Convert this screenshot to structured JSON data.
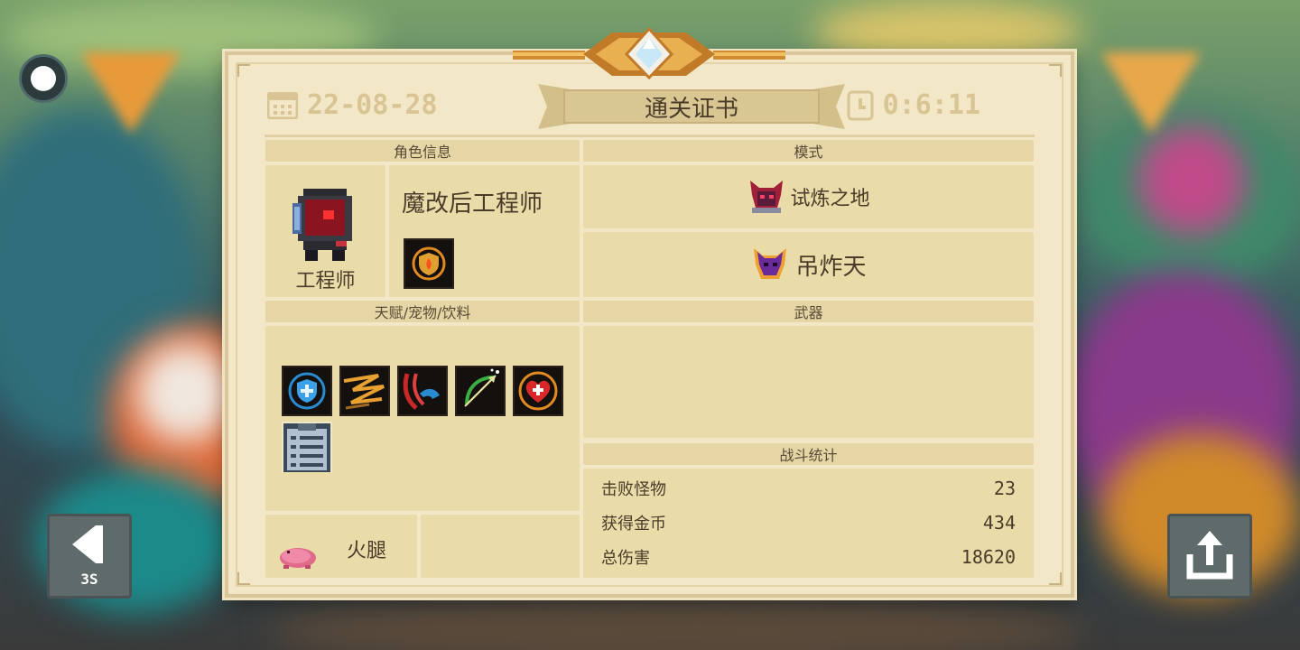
{
  "colors": {
    "panel_bg": "#f2e8c8",
    "section_header_bg": "#e6d6a6",
    "cell_bg": "#eadca9",
    "header_accent": "#d9c493",
    "text": "#4a3b2a"
  },
  "record_button": {
    "icon": "record-dot-icon"
  },
  "back_button": {
    "icon": "back-arrow-icon",
    "countdown": "3S"
  },
  "share_button": {
    "icon": "share-icon"
  },
  "certificate": {
    "title": "通关证书",
    "date": "22-08-28",
    "date_icon": "calendar-icon",
    "time": "0:6:11",
    "time_icon": "clock-icon",
    "character_section": {
      "header": "角色信息",
      "class_name": "工程师",
      "skin_name": "魔改后工程师",
      "skill_icon": "shield-flame-skill-icon"
    },
    "mode_section": {
      "header": "模式",
      "modes": [
        {
          "label": "试炼之地",
          "icon": "trial-demon-icon"
        },
        {
          "label": "吊炸天",
          "icon": "purple-demon-icon"
        }
      ]
    },
    "buffs_section": {
      "header": "天赋/宠物/饮料",
      "items": [
        {
          "icon": "blue-shield-buff-icon"
        },
        {
          "icon": "lightning-trail-buff-icon"
        },
        {
          "icon": "red-dash-buff-icon"
        },
        {
          "icon": "green-bow-buff-icon"
        },
        {
          "icon": "heart-plus-buff-icon"
        },
        {
          "icon": "clipboard-buff-icon"
        }
      ],
      "pet": {
        "label": "火腿",
        "icon": "pink-pig-icon"
      }
    },
    "weapons_section": {
      "header": "武器"
    },
    "stats_section": {
      "header": "战斗统计",
      "rows": [
        {
          "label": "击败怪物",
          "value": "23"
        },
        {
          "label": "获得金币",
          "value": "434"
        },
        {
          "label": "总伤害",
          "value": "18620"
        }
      ]
    }
  }
}
